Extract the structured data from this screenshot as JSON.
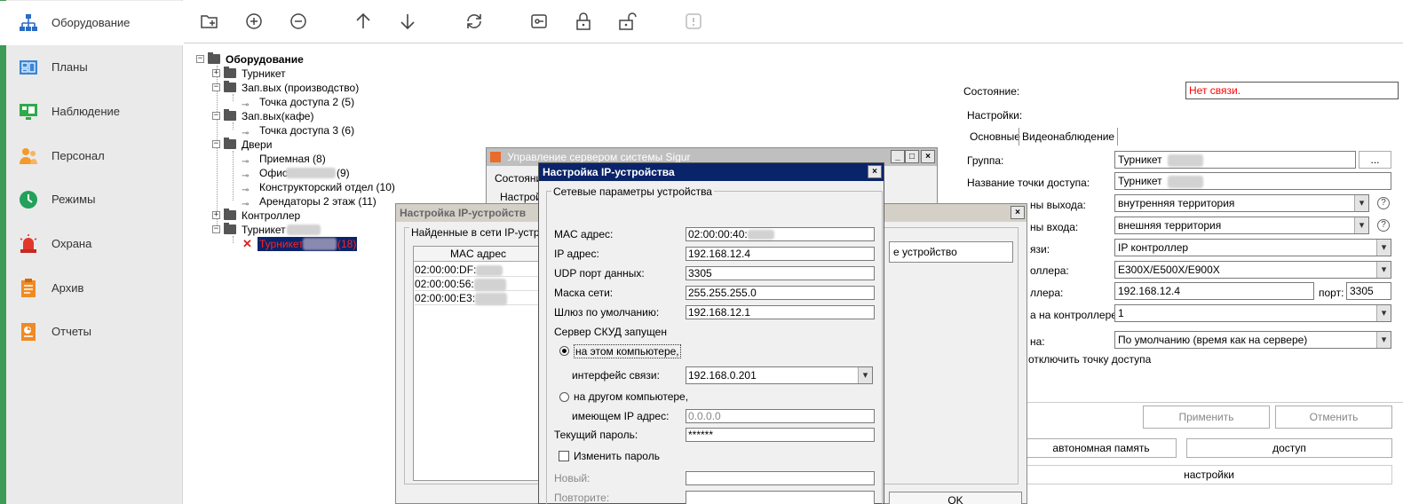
{
  "sidebar": {
    "items": [
      {
        "label": "Оборудование",
        "icon": "hierarchy-icon",
        "active": true
      },
      {
        "label": "Планы",
        "icon": "floorplan-icon"
      },
      {
        "label": "Наблюдение",
        "icon": "monitor-icon"
      },
      {
        "label": "Персонал",
        "icon": "people-icon"
      },
      {
        "label": "Режимы",
        "icon": "clock-icon"
      },
      {
        "label": "Охрана",
        "icon": "alarm-siren-icon"
      },
      {
        "label": "Архив",
        "icon": "clipboard-icon"
      },
      {
        "label": "Отчеты",
        "icon": "report-icon"
      }
    ]
  },
  "toolbar": {
    "icons": [
      "add-folder-icon",
      "add-icon",
      "remove-icon",
      "move-up-icon",
      "move-down-icon",
      "refresh-icon",
      "key-card-icon",
      "unlock-icon",
      "lock-open-icon",
      "alert-icon"
    ]
  },
  "tree": {
    "root": "Оборудование",
    "nodes": [
      {
        "label": "Турникет"
      },
      {
        "label": "Зап.вых (производство)"
      },
      {
        "label": "Точка доступа 2 (5)"
      },
      {
        "label": "Зап.вых(кафе)"
      },
      {
        "label": "Точка доступа 3 (6)"
      },
      {
        "label": "Двери"
      },
      {
        "label": "Приемная (8)"
      },
      {
        "label": "Офис",
        "suffix": "(9)"
      },
      {
        "label": "Конструкторский отдел (10)"
      },
      {
        "label": "Арендаторы 2 этаж (11)"
      },
      {
        "label": "Контроллер"
      },
      {
        "label": "Турникет"
      },
      {
        "label": "Турникет",
        "suffix": "(18)"
      }
    ]
  },
  "props": {
    "state_label": "Состояние:",
    "state_value": "Нет связи.",
    "settings_label": "Настройки:",
    "tab_main": "Основные",
    "tab_video": "Видеонаблюдение",
    "group_label": "Группа:",
    "group_value": "Турникет",
    "browse_label": "...",
    "name_label": "Название точки доступа:",
    "name_value": "Турникет",
    "exit_zone_label": "ны выхода:",
    "exit_zone_value": "внутренняя территория",
    "entry_zone_label": "ны входа:",
    "entry_zone_value": "внешняя территория",
    "link_type_label": "язи:",
    "link_type_value": "IP контроллер",
    "controller_type_label": "оллера:",
    "controller_type_value": "E300X/E500X/E900X",
    "controller_ip_label": "ллера:",
    "controller_ip_value": "192.168.12.4",
    "port_label": "порт:",
    "port_value": "3305",
    "controller_num_label": "а на контроллере:",
    "controller_num_value": "1",
    "timezone_label": "на:",
    "timezone_value": "По умолчанию (время как на сервере)",
    "disable_label": "отключить точку доступа",
    "apply_label": "Применить",
    "cancel_label": "Отменить",
    "memory_label": "автономная память",
    "access_label": "доступ",
    "settings_button": "настройки"
  },
  "server_window": {
    "title": "Управление сервером системы Sigur",
    "state_label": "Состояни",
    "settings_label": "Настрой"
  },
  "scan_window": {
    "title": "Настройка IP-устройств",
    "group_label": "Найденные в сети IP-устрой",
    "col_mac": "MAC адрес",
    "rows": [
      "02:00:00:DF:",
      "02:00:00:56:",
      "02:00:00:E3:"
    ],
    "device_button": "е устройство",
    "ok_label": "OK"
  },
  "device_dialog": {
    "title": "Настройка IP-устройства",
    "group_label": "Сетевые параметры устройства",
    "mac_label": "MAC адрес:",
    "mac_value": "02:00:00:40:",
    "ip_label": "IP адрес:",
    "ip_value": "192.168.12.4",
    "udp_label": "UDP порт данных:",
    "udp_value": "3305",
    "mask_label": "Маска сети:",
    "mask_value": "255.255.255.0",
    "gateway_label": "Шлюз по умолчанию:",
    "gateway_value": "192.168.12.1",
    "server_label": "Сервер СКУД запущен",
    "this_pc_label": "на этом компьютере,",
    "iface_label": "интерфейс связи:",
    "iface_value": "192.168.0.201",
    "other_pc_label": "на другом компьютере,",
    "other_ip_label": "имеющем IP адрес:",
    "other_ip_value": "0.0.0.0",
    "password_label": "Текущий пароль:",
    "password_value": "******",
    "change_password_label": "Изменить пароль",
    "new_label": "Новый:",
    "repeat_label": "Повторите:"
  },
  "colors": {
    "accent_green": "#3d9b55",
    "title_active": "#0a246a",
    "error_red": "#ff0000",
    "selection": "#0a246a"
  }
}
